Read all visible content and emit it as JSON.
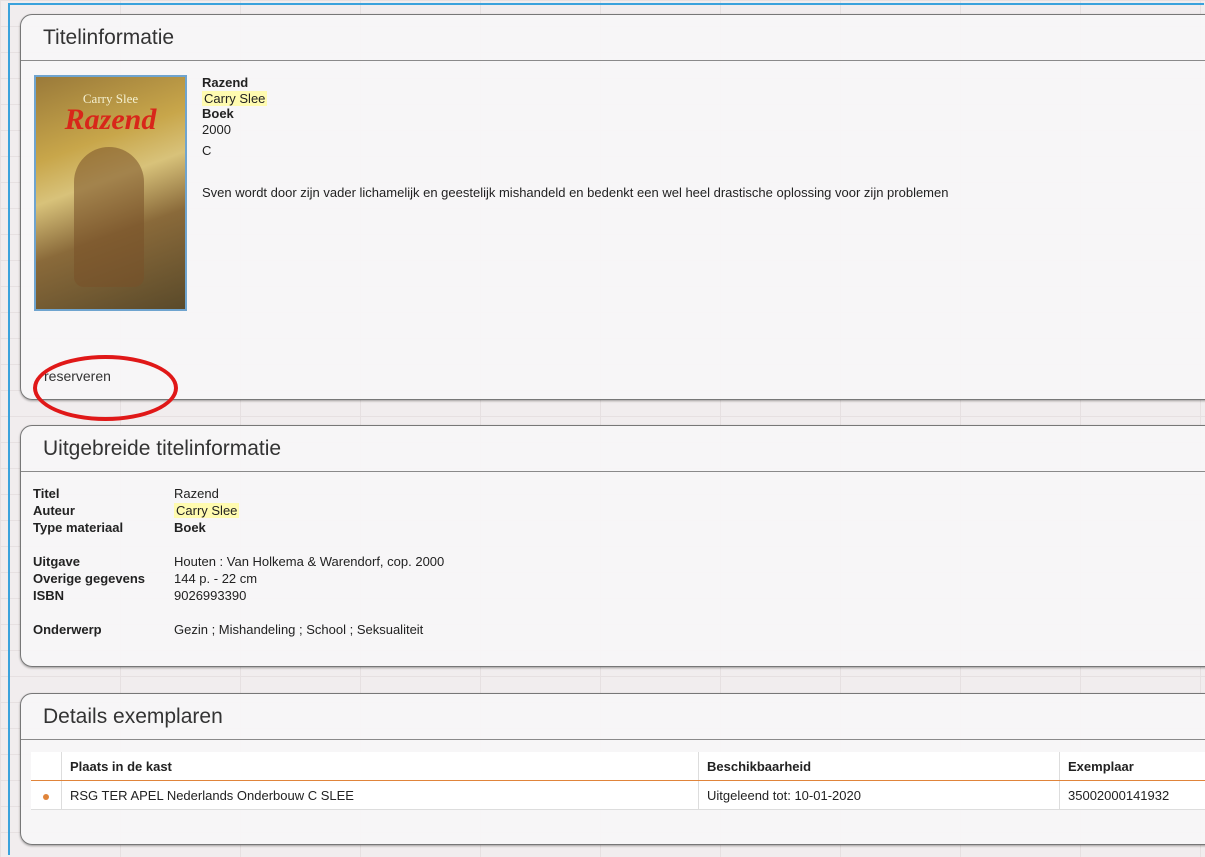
{
  "panel_title": {
    "title": "Titelinformatie"
  },
  "book": {
    "title": "Razend",
    "author": "Carry Slee",
    "type": "Boek",
    "year": "2000",
    "level": "C",
    "summary": "Sven wordt door zijn vader lichamelijk en geestelijk mishandeld en bedenkt een wel heel drastische oplossing voor zijn problemen",
    "cover_author": "Carry Slee",
    "cover_title": "Razend"
  },
  "actions": {
    "reserve_label": "reserveren"
  },
  "extended": {
    "title": "Uitgebreide titelinformatie",
    "rows": [
      {
        "label": "Titel",
        "value": "Razend"
      },
      {
        "label": "Auteur",
        "value": "Carry Slee"
      },
      {
        "label": "Type materiaal",
        "value": "Boek"
      },
      {
        "label": "Uitgave",
        "value": "Houten : Van Holkema & Warendorf, cop. 2000"
      },
      {
        "label": "Overige gegevens",
        "value": "144 p. - 22 cm"
      },
      {
        "label": "ISBN",
        "value": "9026993390"
      },
      {
        "label": "Onderwerp",
        "value": "Gezin ; Mishandeling ; School ; Seksualiteit"
      }
    ]
  },
  "copies": {
    "title": "Details exemplaren",
    "columns": [
      "Plaats in de kast",
      "Beschikbaarheid",
      "Exemplaar"
    ],
    "rows": [
      {
        "location": "RSG TER APEL Nederlands Onderbouw C SLEE",
        "availability": "Uitgeleend tot: 10-01-2020",
        "copy_id": "35002000141932"
      }
    ]
  },
  "colors": {
    "highlight": "#fffbb0",
    "annotation_circle": "#e01818",
    "frame_accent": "#3aa2dc",
    "row_marker": "#e0843a"
  }
}
